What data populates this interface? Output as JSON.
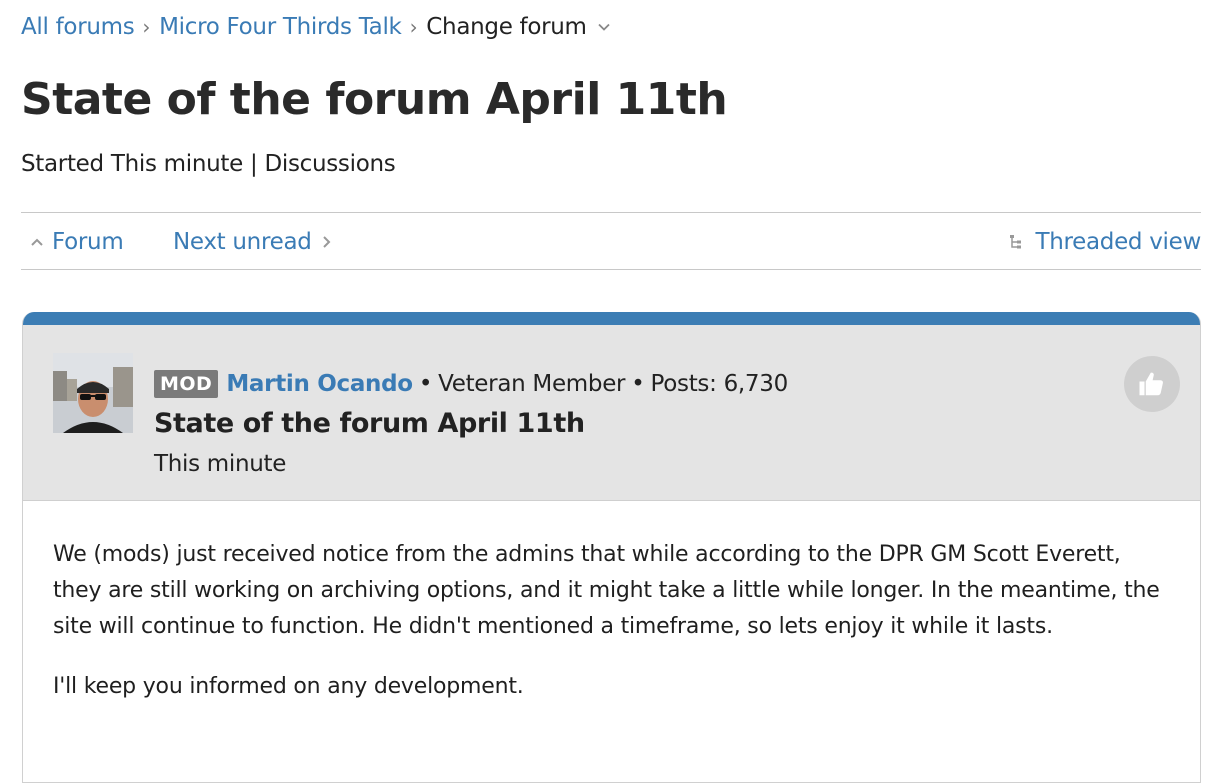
{
  "breadcrumb": {
    "all_forums": "All forums",
    "forum_name": "Micro Four Thirds Talk",
    "change_forum": "Change forum"
  },
  "thread": {
    "title": "State of the forum April 11th",
    "meta": "Started This minute | Discussions"
  },
  "nav": {
    "forum": "Forum",
    "next_unread": "Next unread",
    "threaded_view": "Threaded view"
  },
  "post": {
    "badge": "MOD",
    "author": "Martin Ocando",
    "rank": "Veteran Member",
    "posts_label": "Posts: 6,730",
    "subject": "State of the forum April 11th",
    "time": "This minute",
    "body": [
      "We (mods) just received notice from the admins that while according to the DPR GM Scott Everett, they are still working on archiving options, and it might take a little while longer. In the meantime, the site will continue to function. He didn't mentioned a timeframe, so lets enjoy it while it lasts.",
      "I'll keep you informed on any development."
    ]
  },
  "icons": {
    "breadcrumb_separator": "chevron-right-icon",
    "change_forum": "chevron-down-icon",
    "forum": "chevron-up-icon",
    "next_unread": "chevron-right-icon",
    "threaded_view": "tree-icon",
    "like": "thumbs-up-icon"
  },
  "colors": {
    "link": "#3a7bb5",
    "post_topbar": "#3c7db4",
    "post_header_bg": "#e4e4e4",
    "mod_badge": "#7a7a7a"
  }
}
